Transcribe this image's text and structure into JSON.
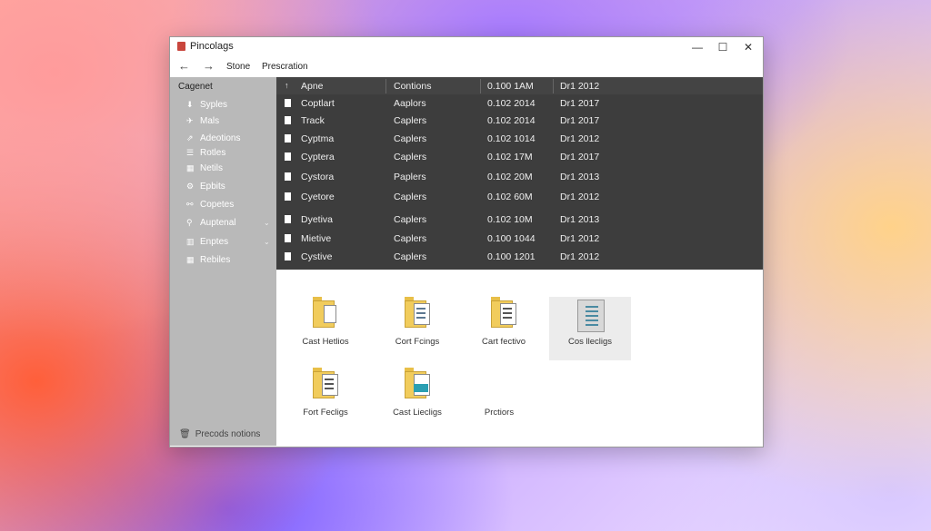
{
  "window": {
    "title": "Pincolags",
    "controls": {
      "minimize": "—",
      "maximize": "☐",
      "close": "✕"
    }
  },
  "toolbar": {
    "back_icon": "arrow-left-icon",
    "forward_icon": "arrow-right-icon",
    "breadcrumbs": [
      "Stone",
      "Prescration"
    ]
  },
  "sidebar": {
    "header": "Cagenet",
    "items": [
      {
        "label": "Syples",
        "icon": "down-arrow-icon"
      },
      {
        "label": "Mals",
        "icon": "pin-icon"
      },
      {
        "label": "Adeotions",
        "icon": "share-icon"
      },
      {
        "label": "Rotles",
        "icon": "list-icon"
      },
      {
        "label": "Netils",
        "icon": "grid-icon"
      },
      {
        "label": "Epbits",
        "icon": "gear-icon"
      },
      {
        "label": "Copetes",
        "icon": "link-icon"
      },
      {
        "label": "Auptenal",
        "icon": "search-icon",
        "chevron": true
      },
      {
        "label": "Enptes",
        "icon": "building-icon",
        "chevron": true
      },
      {
        "label": "Rebiles",
        "icon": "grid-icon"
      }
    ],
    "footer": "Precods notions",
    "footer_icon": "trash-icon"
  },
  "file_list": {
    "columns": [
      "Apne",
      "Contions",
      "0.100 1AM",
      "Dr1 2012"
    ],
    "rows": [
      [
        "Coptlart",
        "Aaplors",
        "0.102 2014",
        "Dr1 2017"
      ],
      [
        "Track",
        "Caplers",
        "0.102 2014",
        "Dr1 2017"
      ],
      [
        "Cyptma",
        "Caplers",
        "0.102 1014",
        "Dr1 2012"
      ],
      [
        "Cyptera",
        "Caplers",
        "0.102 17M",
        "Dr1 2017"
      ],
      [
        "Cystora",
        "Paplers",
        "0.102 20M",
        "Dr1 2013"
      ],
      [
        "Cyetore",
        "Caplers",
        "0.102 60M",
        "Dr1 2012"
      ],
      [
        "Dyetiva",
        "Caplers",
        "0.102 10M",
        "Dr1 2013"
      ],
      [
        "Mietive",
        "Caplers",
        "0.100 1044",
        "Dr1 2012"
      ],
      [
        "Cystive",
        "Caplers",
        "0.100 1201",
        "Dr1 2012"
      ]
    ]
  },
  "icon_view": {
    "tiles": [
      {
        "label": "Cast Hetlios",
        "icon": "folder-icon"
      },
      {
        "label": "Cort Fcings",
        "icon": "folder-document-icon"
      },
      {
        "label": "Cart fectivo",
        "icon": "folder-document-icon"
      },
      {
        "label": "Cos llecligs",
        "icon": "document-icon",
        "selected": true
      },
      {
        "label": "Fort Fecligs",
        "icon": "folder-document-icon"
      },
      {
        "label": "Cast Liecligs",
        "icon": "folder-image-icon"
      },
      {
        "label": "Prctiors",
        "icon": "none"
      }
    ]
  },
  "colors": {
    "sidebar_bg": "#b9b9b9",
    "list_bg": "#3d3d3d",
    "folder_yellow": "#f1cc5c"
  }
}
